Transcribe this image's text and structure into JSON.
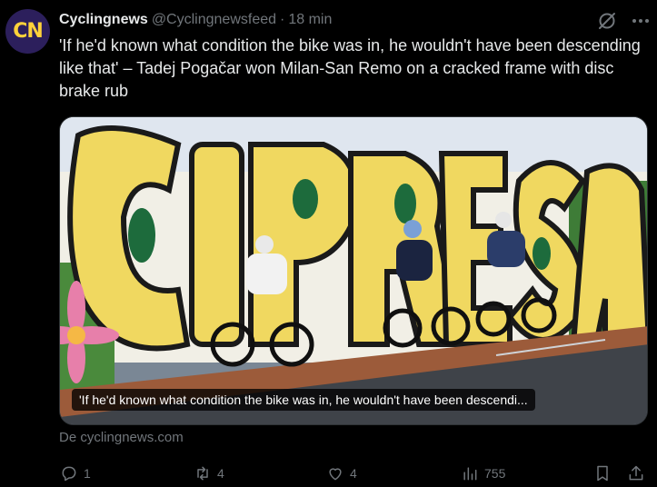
{
  "author": {
    "avatar_text": "CN",
    "display_name": "Cyclingnews",
    "handle": "@Cyclingnewsfeed",
    "separator": "·",
    "time": "18 min"
  },
  "tweet": {
    "text": "'If he'd known what condition the bike was in, he wouldn't have been descending like that' – Tadej Pogačar won Milan-San Remo on a cracked frame with disc brake rub"
  },
  "card": {
    "image_wall_text": "CIPRESSA",
    "caption": "'If he'd known what condition the bike was in, he wouldn't have been descendi...",
    "source": "De cyclingnews.com"
  },
  "actions": {
    "replies": "1",
    "reposts": "4",
    "likes": "4",
    "views": "755"
  },
  "icons": {
    "grok": "grok-icon",
    "more": "more-icon",
    "reply": "reply-icon",
    "repost": "repost-icon",
    "like": "heart-icon",
    "views": "views-chart-icon",
    "bookmark": "bookmark-icon",
    "share": "share-icon"
  },
  "colors": {
    "background": "#000000",
    "text": "#e7e9ea",
    "muted": "#71767b",
    "avatar_bg": "#2c1f5c",
    "avatar_fg": "#ffd23a",
    "wall_yellow": "#f0d860"
  }
}
